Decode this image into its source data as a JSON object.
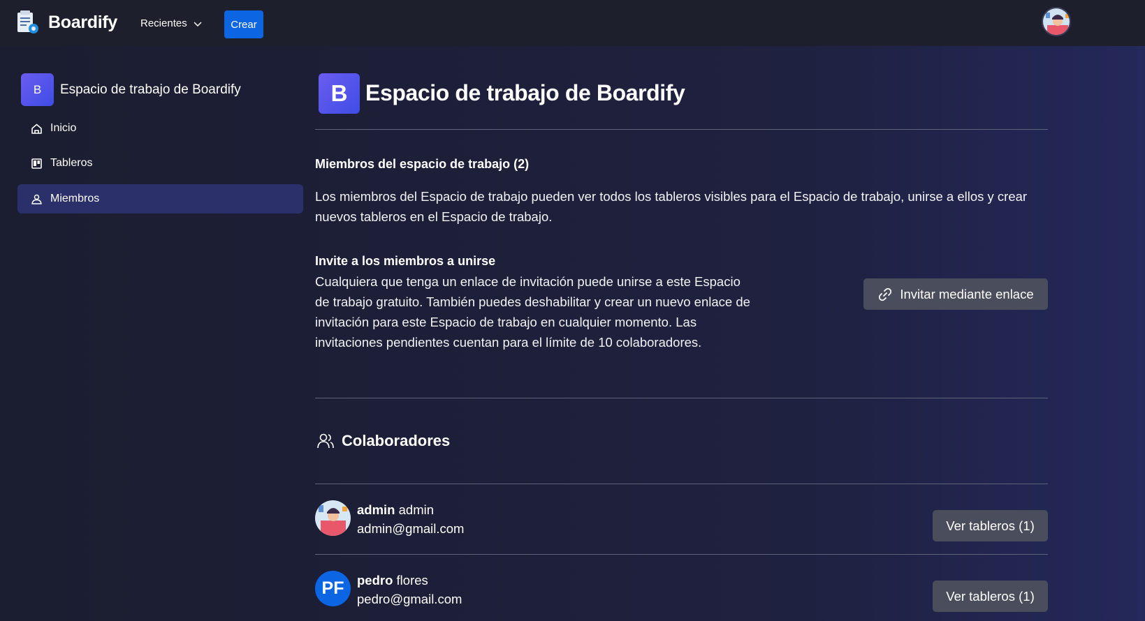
{
  "header": {
    "brand": "Boardify",
    "recent_label": "Recientes",
    "create_label": "Crear"
  },
  "sidebar": {
    "workspace_initial": "B",
    "workspace_name": "Espacio de trabajo de Boardify",
    "items": [
      {
        "label": "Inicio",
        "icon": "home-icon"
      },
      {
        "label": "Tableros",
        "icon": "board-icon"
      },
      {
        "label": "Miembros",
        "icon": "members-icon",
        "active": true
      }
    ]
  },
  "main": {
    "workspace_initial": "B",
    "workspace_title": "Espacio de trabajo de Boardify",
    "members_heading": "Miembros del espacio de trabajo (2)",
    "members_description": "Los miembros del Espacio de trabajo pueden ver todos los tableros visibles para el Espacio de trabajo, unirse a ellos y crear nuevos tableros en el Espacio de trabajo.",
    "invite_heading": "Invite a los miembros a unirse",
    "invite_description": "Cualquiera que tenga un enlace de invitación puede unirse a este Espacio de trabajo gratuito. También puedes deshabilitar y crear un nuevo enlace de invitación para este Espacio de trabajo en cualquier momento. Las invitaciones pendientes cuentan para el límite de 10 colaboradores.",
    "invite_button": "Invitar mediante enlace",
    "collaborators_title": "Colaboradores",
    "collaborators": [
      {
        "first": "admin",
        "last": "admin",
        "email": "admin@gmail.com",
        "button": "Ver tableros (1)"
      },
      {
        "first": "pedro",
        "last": "flores",
        "email": "pedro@gmail.com",
        "initials": "PF",
        "button": "Ver tableros (1)"
      }
    ]
  },
  "colors": {
    "accent": "#0c66e4",
    "workspace_badge": "#5b55ec",
    "active_nav": "#2b306a",
    "header_bg": "#1d1f2c"
  }
}
